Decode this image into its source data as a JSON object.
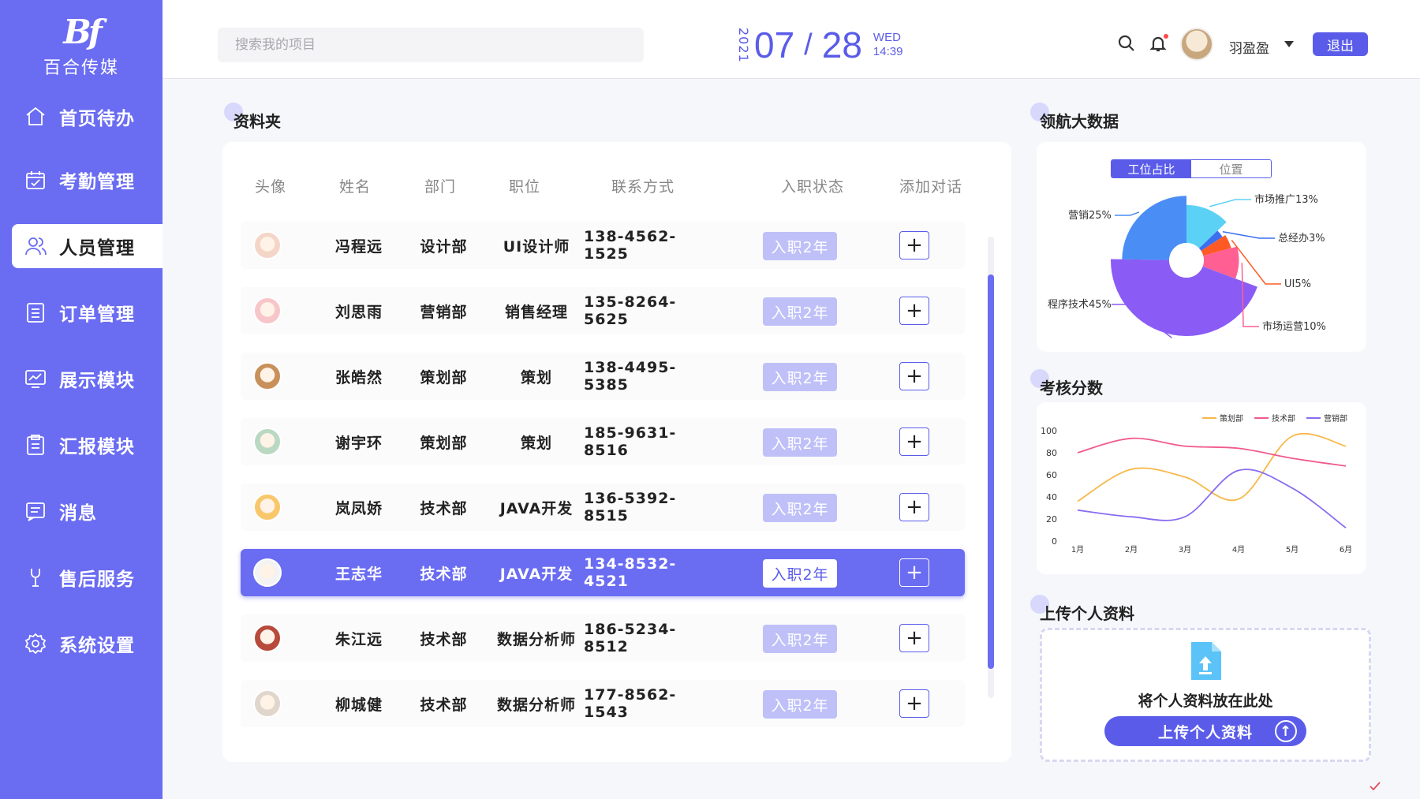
{
  "brand": {
    "mark": "Bf",
    "name": "百合传媒"
  },
  "sidebar": {
    "items": [
      {
        "label": "首页待办",
        "icon": "home-icon"
      },
      {
        "label": "考勤管理",
        "icon": "calendar-check-icon"
      },
      {
        "label": "人员管理",
        "icon": "users-icon",
        "active": true
      },
      {
        "label": "订单管理",
        "icon": "list-icon"
      },
      {
        "label": "展示模块",
        "icon": "chart-screen-icon"
      },
      {
        "label": "汇报模块",
        "icon": "clipboard-icon"
      },
      {
        "label": "消息",
        "icon": "message-icon"
      },
      {
        "label": "售后服务",
        "icon": "service-icon"
      },
      {
        "label": "系统设置",
        "icon": "gear-icon"
      }
    ]
  },
  "header": {
    "search_placeholder": "搜索我的项目",
    "year": "2021",
    "month": "07",
    "slash": "/",
    "day": "28",
    "weekday": "WED",
    "time": "14:39",
    "username": "羽盈盈",
    "logout_label": "退出"
  },
  "folder": {
    "title": "资料夹",
    "columns": [
      "头像",
      "姓名",
      "部门",
      "职位",
      "联系方式",
      "入职状态",
      "添加对话"
    ],
    "rows": [
      {
        "name": "冯程远",
        "dept": "设计部",
        "position": "UI设计师",
        "phone": "138-4562-1525",
        "status": "入职2年",
        "add": "+"
      },
      {
        "name": "刘思雨",
        "dept": "营销部",
        "position": "销售经理",
        "phone": "135-8264-5625",
        "status": "入职2年",
        "add": "+"
      },
      {
        "name": "张皓然",
        "dept": "策划部",
        "position": "策划",
        "phone": "138-4495-5385",
        "status": "入职2年",
        "add": "+"
      },
      {
        "name": "谢宇环",
        "dept": "策划部",
        "position": "策划",
        "phone": "185-9631-8516",
        "status": "入职2年",
        "add": "+"
      },
      {
        "name": "岚凤娇",
        "dept": "技术部",
        "position": "JAVA开发",
        "phone": "136-5392-8515",
        "status": "入职2年",
        "add": "+"
      },
      {
        "name": "王志华",
        "dept": "技术部",
        "position": "JAVA开发",
        "phone": "134-8532-4521",
        "status": "入职2年",
        "add": "+",
        "selected": true
      },
      {
        "name": "朱江远",
        "dept": "技术部",
        "position": "数据分析师",
        "phone": "186-5234-8512",
        "status": "入职2年",
        "add": "+"
      },
      {
        "name": "柳城健",
        "dept": "技术部",
        "position": "数据分析师",
        "phone": "177-8562-1543",
        "status": "入职2年",
        "add": "+"
      }
    ]
  },
  "bigdata": {
    "title": "领航大数据",
    "tabs": [
      "工位占比",
      "位置"
    ],
    "active_tab": "工位占比"
  },
  "score": {
    "title": "考核分数"
  },
  "upload": {
    "title": "上传个人资料",
    "drop_text": "将个人资料放在此处",
    "button_label": "上传个人资料"
  },
  "colors": {
    "accent": "#5a5ce9",
    "sidebar": "#6a6cf2"
  },
  "chart_data": [
    {
      "type": "pie",
      "slices": [
        {
          "label": "营销25%",
          "value": 25,
          "color": "#4a8ef5"
        },
        {
          "label": "市场推广13%",
          "value": 13,
          "color": "#5bd2f5"
        },
        {
          "label": "总经办3%",
          "value": 3,
          "color": "#3c6ef0"
        },
        {
          "label": "UI5%",
          "value": 5,
          "color": "#ff5a26"
        },
        {
          "label": "市场运营10%",
          "value": 10,
          "color": "#ff5f93"
        },
        {
          "label": "程序技术45%",
          "value": 45,
          "color": "#8a5cf5"
        }
      ]
    },
    {
      "type": "line",
      "categories": [
        "1月",
        "2月",
        "3月",
        "4月",
        "5月",
        "6月"
      ],
      "ylim": [
        0,
        100
      ],
      "yticks": [
        0,
        20,
        40,
        60,
        80,
        100
      ],
      "series": [
        {
          "name": "策划部",
          "color": "#f7b84a",
          "values": [
            36,
            65,
            58,
            38,
            95,
            86
          ]
        },
        {
          "name": "技术部",
          "color": "#f05a8c",
          "values": [
            80,
            93,
            86,
            84,
            75,
            68
          ]
        },
        {
          "name": "营销部",
          "color": "#8a6cf0",
          "values": [
            28,
            22,
            22,
            64,
            48,
            12
          ]
        }
      ]
    }
  ]
}
